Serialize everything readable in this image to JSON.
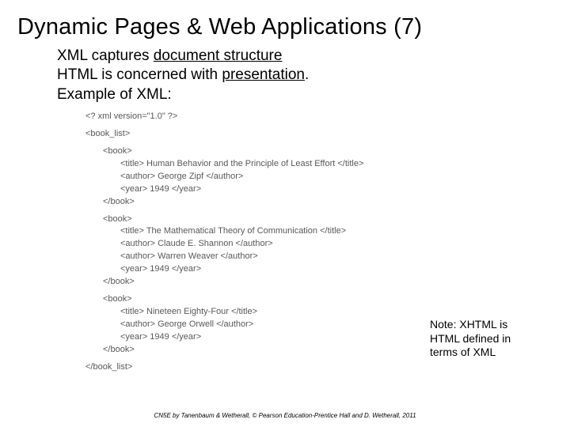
{
  "title": "Dynamic Pages & Web Applications (7)",
  "body": {
    "line1_a": "XML captures ",
    "line1_b": "document structure",
    "line2_a": "HTML is concerned with ",
    "line2_b": "presentation",
    "line2_c": ".",
    "line3": "Example of XML:"
  },
  "code": {
    "l01": "<? xml version=\"1.0\" ?>",
    "l02": "<book_list>",
    "l03": "<book>",
    "l04": "<title> Human Behavior and the Principle of Least Effort </title>",
    "l05": "<author> George Zipf </author>",
    "l06": "<year> 1949 </year>",
    "l07": "</book>",
    "l08": "<book>",
    "l09": "<title> The Mathematical Theory of Communication </title>",
    "l10": "<author> Claude E. Shannon </author>",
    "l11": "<author> Warren Weaver </author>",
    "l12": "<year> 1949 </year>",
    "l13": "</book>",
    "l14": "<book>",
    "l15": "<title> Nineteen Eighty-Four </title>",
    "l16": "<author> George Orwell </author>",
    "l17": "<year> 1949 </year>",
    "l18": "</book>",
    "l19": "</book_list>"
  },
  "note": "Note: XHTML is HTML defined in terms of XML",
  "footer": "CN5E by Tanenbaum & Wetherall, © Pearson Education-Prentice Hall and D. Wetherall, 2011"
}
